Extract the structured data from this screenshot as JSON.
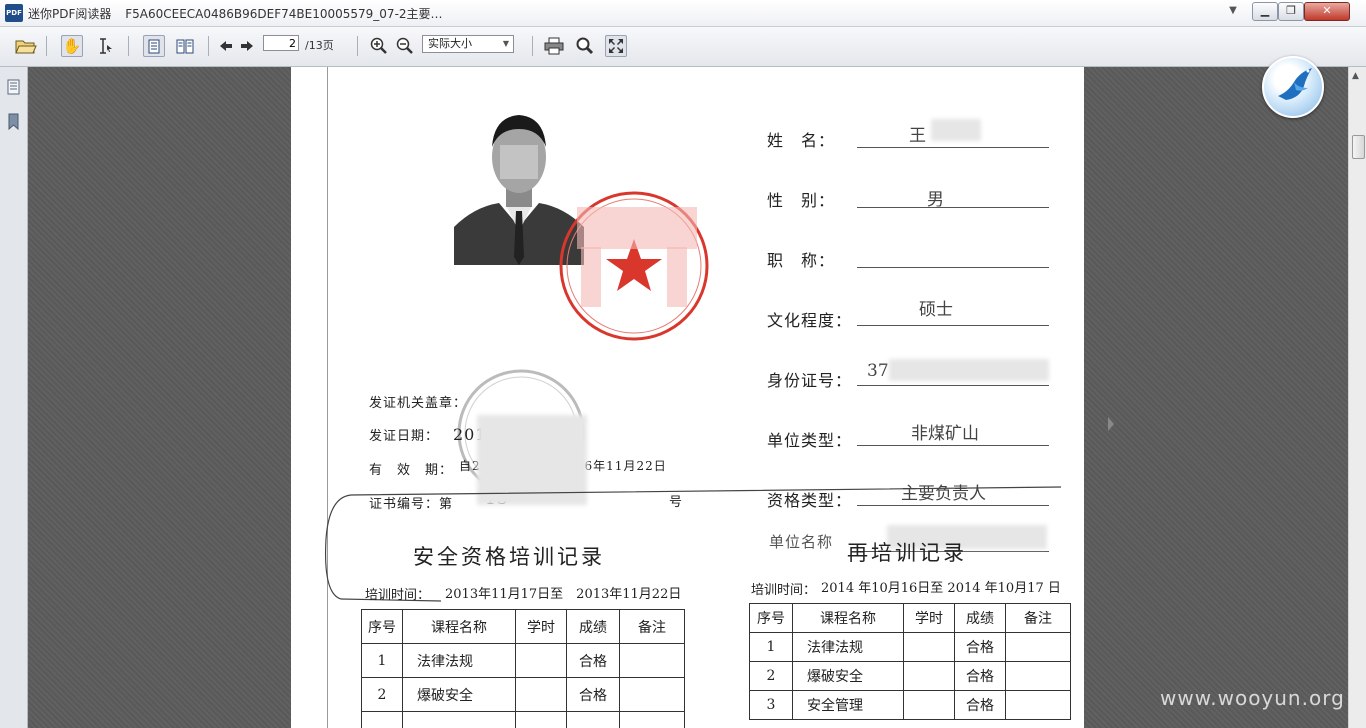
{
  "window": {
    "app_icon_text": "PDF",
    "app_name": "迷你PDF阅读器",
    "file_name": "F5A60CEECA0486B96DEF74BE10005579_07-2主要…"
  },
  "toolbar": {
    "current_page": "2",
    "total_pages": "/13页",
    "zoom_value": "实际大小"
  },
  "watermark": "www.wooyun.org",
  "document": {
    "fields": [
      {
        "label": "姓　名：",
        "value": "王"
      },
      {
        "label": "性　别：",
        "value": "男"
      },
      {
        "label": "职　称：",
        "value": ""
      },
      {
        "label": "文化程度：",
        "value": "硕士"
      },
      {
        "label": "身份证号：",
        "value": "37"
      },
      {
        "label": "单位类型：",
        "value": "非煤矿山"
      },
      {
        "label": "资格类型：",
        "value": "主要负责人"
      },
      {
        "label": "单位名称",
        "value": ""
      }
    ],
    "issuer": {
      "seal_label": "发证机关盖章：",
      "date_label": "发证日期：",
      "date_value": "201　年　月",
      "valid_label": "有　效　期：",
      "valid_value": "自2　年11　日至　16年11月22日",
      "cert_label": "证书编号：第",
      "cert_value": "13",
      "cert_suffix": "号"
    },
    "left_section": {
      "title": "安全资格培训记录",
      "time_label": "培训时间：",
      "time_value": "2013年11月17日至　2013年11月22日",
      "headers": [
        "序号",
        "课程名称",
        "学时",
        "成绩",
        "备注"
      ],
      "rows": [
        {
          "no": "1",
          "name": "法律法规",
          "hours": "",
          "score": "合格",
          "note": ""
        },
        {
          "no": "2",
          "name": "爆破安全",
          "hours": "",
          "score": "合格",
          "note": ""
        }
      ]
    },
    "right_section": {
      "title": "再培训记录",
      "time_label": "培训时间：",
      "time_value": "2014 年10月16日至 2014 年10月17 日",
      "headers": [
        "序号",
        "课程名称",
        "学时",
        "成绩",
        "备注"
      ],
      "rows": [
        {
          "no": "1",
          "name": "法律法规",
          "hours": "",
          "score": "合格",
          "note": ""
        },
        {
          "no": "2",
          "name": "爆破安全",
          "hours": "",
          "score": "合格",
          "note": ""
        },
        {
          "no": "3",
          "name": "安全管理",
          "hours": "",
          "score": "合格",
          "note": ""
        }
      ]
    }
  },
  "colors": {
    "seal_red": "#d9362c",
    "viewer_bg": "#5c5c5c",
    "close_button": "#c0392b"
  }
}
